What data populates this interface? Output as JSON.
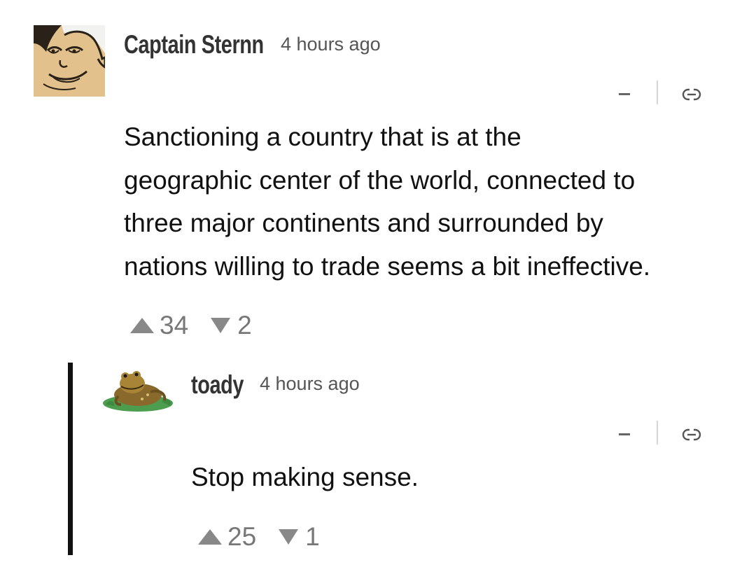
{
  "comments": [
    {
      "author": "Captain Sternn",
      "timestamp": "4 hours ago",
      "avatar_icon": "cartoon-face-avatar",
      "text_lines": [
        "Sanctioning a country that is at the",
        "geographic center of the world, connected to",
        "three major continents and surrounded by",
        "nations willing to trade seems a bit ineffective."
      ],
      "upvotes": "34",
      "downvotes": "2"
    },
    {
      "author": "toady",
      "timestamp": "4 hours ago",
      "avatar_icon": "toad-avatar",
      "text_lines": [
        "Stop making sense."
      ],
      "upvotes": "25",
      "downvotes": "1"
    }
  ],
  "icons": {
    "collapse": "minus-icon",
    "permalink": "link-icon",
    "upvote": "triangle-up-icon",
    "downvote": "triangle-down-icon"
  },
  "colors": {
    "text": "#111111",
    "meta": "#555555",
    "votes": "#777777",
    "thread_bar": "#111111"
  }
}
